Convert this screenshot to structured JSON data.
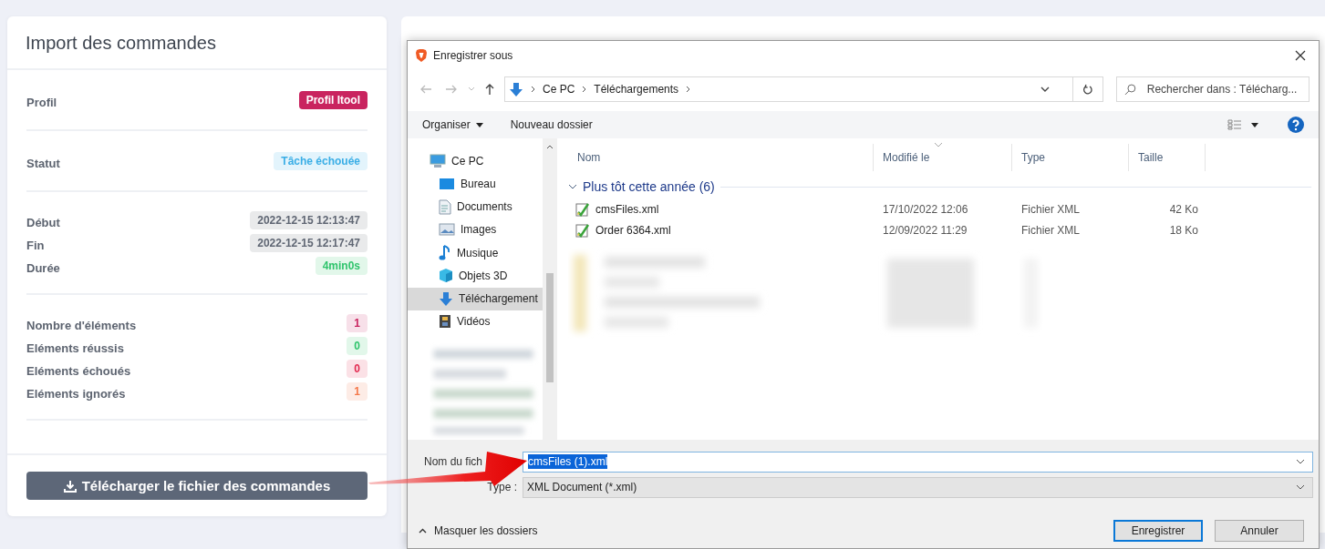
{
  "import_panel": {
    "title": "Import des commandes",
    "sections": [
      {
        "rows": [
          {
            "label": "Profil",
            "value": "Profil Itool",
            "kind": "solid",
            "color": "#c9245f"
          }
        ]
      },
      {
        "rows": [
          {
            "label": "Statut",
            "value": "Tâche échouée",
            "kind": "soft",
            "color": "#3aaee6"
          }
        ]
      },
      {
        "rows": [
          {
            "label": "Début",
            "value": "2022-12-15 12:13:47",
            "kind": "soft",
            "color": "#5f6673"
          },
          {
            "label": "Fin",
            "value": "2022-12-15 12:17:47",
            "kind": "soft",
            "color": "#5f6673"
          },
          {
            "label": "Durée",
            "value": "4min0s",
            "kind": "soft",
            "color": "#2fc46c"
          }
        ]
      },
      {
        "rows": [
          {
            "label": "Nombre d'éléments",
            "value": "1",
            "kind": "soft",
            "color": "#c9245f"
          },
          {
            "label": "Eléments réussis",
            "value": "0",
            "kind": "soft",
            "color": "#2fc46c"
          },
          {
            "label": "Eléments échoués",
            "value": "0",
            "kind": "soft",
            "color": "#e2294f"
          },
          {
            "label": "Eléments ignorés",
            "value": "1",
            "kind": "soft",
            "color": "#f4784a"
          }
        ]
      }
    ],
    "download_button": "Télécharger le fichier des commandes"
  },
  "save_dialog": {
    "title": "Enregistrer sous",
    "breadcrumb": [
      "Ce PC",
      "Téléchargements"
    ],
    "search": {
      "placeholder": "Rechercher dans : Télécharg..."
    },
    "toolbar": {
      "organize": "Organiser",
      "new_folder": "Nouveau dossier"
    },
    "nav_items": [
      {
        "label": "Ce PC",
        "kind": "pc",
        "selected": false,
        "children": [
          {
            "label": "Bureau",
            "kind": "desktop",
            "selected": false
          },
          {
            "label": "Documents",
            "kind": "documents",
            "selected": false
          },
          {
            "label": "Images",
            "kind": "images",
            "selected": false
          },
          {
            "label": "Musique",
            "kind": "music",
            "selected": false
          },
          {
            "label": "Objets 3D",
            "kind": "objects3d",
            "selected": false
          },
          {
            "label": "Téléchargement",
            "kind": "downloads",
            "selected": true
          },
          {
            "label": "Vidéos",
            "kind": "videos",
            "selected": false
          }
        ]
      }
    ],
    "columns": [
      "Nom",
      "Modifié le",
      "Type",
      "Taille"
    ],
    "group": {
      "label": "Plus tôt cette année (6)",
      "expanded": true
    },
    "files": [
      {
        "name": "cmsFiles.xml",
        "modified": "17/10/2022 12:06",
        "type": "Fichier XML",
        "size": "42 Ko"
      },
      {
        "name": "Order 6364.xml",
        "modified": "12/09/2022 11:29",
        "type": "Fichier XML",
        "size": "18 Ko"
      }
    ],
    "filename": {
      "label": "Nom du fich",
      "value": "cmsFiles (1).xml"
    },
    "file_type": {
      "label": "Type :",
      "value": "XML Document (*.xml)"
    },
    "hide_folders": "Masquer les dossiers",
    "buttons": [
      {
        "label": "Enregistrer",
        "default": true
      },
      {
        "label": "Annuler",
        "default": false
      }
    ]
  }
}
